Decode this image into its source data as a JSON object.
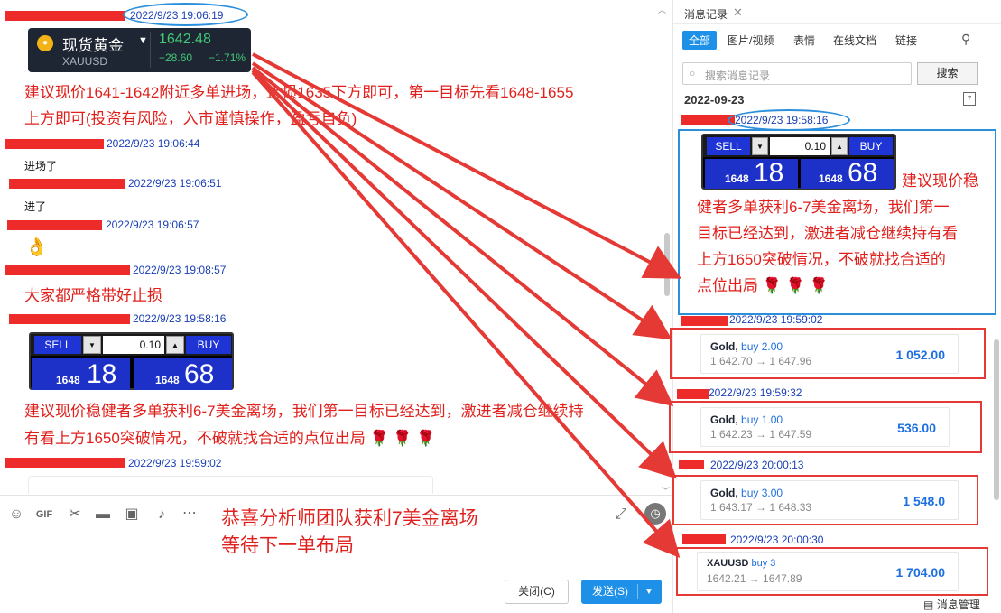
{
  "chat": {
    "header_ts": "2022/9/23 19:06:19",
    "quote": {
      "name": "现货黄金",
      "symbol": "XAUUSD",
      "price": "1642.48",
      "change": "−28.60",
      "change_pct": "−1.71%"
    },
    "advice_line1": "建议现价1641-1642附近多单进场，止损1635下方即可，第一目标先看1648-1655",
    "advice_line2": "上方即可(投资有风险，入市谨慎操作，盈亏自负)",
    "messages": [
      {
        "ts": "2022/9/23 19:06:44",
        "text": "进场了"
      },
      {
        "ts": "2022/9/23 19:06:51",
        "text": "进了"
      },
      {
        "ts": "2022/9/23 19:06:57",
        "text": "👌"
      },
      {
        "ts": "2022/9/23 19:08:57",
        "text": "大家都严格带好止损"
      },
      {
        "ts": "2022/9/23 19:58:16",
        "text": ""
      }
    ],
    "ticket": {
      "sell": "SELL",
      "buy": "BUY",
      "lot": "0.10",
      "sell_small": "1648",
      "sell_big": "18",
      "buy_small": "1648",
      "buy_big": "68"
    },
    "exit_advice_line1": "建议现价稳健者多单获利6-7美金离场，我们第一目标已经达到，激进者减仓继续持",
    "exit_advice_line2": "有看上方1650突破情况，不破就找合适的点位出局 🌹 🌹 🌹",
    "last_ts": "2022/9/23 19:59:02",
    "overlay_line1": "恭喜分析师团队获利7美金离场",
    "overlay_line2": "等待下一单布局",
    "close_label": "关闭(C)",
    "send_label": "发送(S)"
  },
  "panel": {
    "title": "消息记录",
    "tabs": [
      "全部",
      "图片/视频",
      "表情",
      "在线文档",
      "链接"
    ],
    "search_placeholder": "搜索消息记录",
    "search_button": "搜索",
    "date": "2022-09-23",
    "ts_1": "2022/9/23 19:58:16",
    "ticket": {
      "sell": "SELL",
      "buy": "BUY",
      "lot": "0.10",
      "sell_small": "1648",
      "sell_big": "18",
      "buy_small": "1648",
      "buy_big": "68"
    },
    "advice_lines": [
      "建议现价稳",
      "健者多单获利6-7美金离场，我们第一",
      "目标已经达到，激进者减仓继续持有看",
      "上方1650突破情况，不破就找合适的",
      "点位出局 🌹 🌹 🌹"
    ],
    "trades": [
      {
        "ts": "2022/9/23 19:59:02",
        "title": "Gold,",
        "buy": "buy 2.00",
        "path": "1 642.70 → 1 647.96",
        "profit": "1 052.00"
      },
      {
        "ts": "2022/9/23 19:59:32",
        "title": "Gold,",
        "buy": "buy 1.00",
        "path": "1 642.23 → 1 647.59",
        "profit": "536.00"
      },
      {
        "ts": "2022/9/23 20:00:13",
        "title": "Gold,",
        "buy": "buy 3.00",
        "path": "1 643.17 → 1 648.33",
        "profit": "1 548.0"
      },
      {
        "ts": "2022/9/23 20:00:30",
        "title": "XAUUSD",
        "buy": "buy 3",
        "path": "1642.21 → 1647.89",
        "profit": "1 704.00"
      }
    ],
    "manage_label": "消息管理"
  }
}
